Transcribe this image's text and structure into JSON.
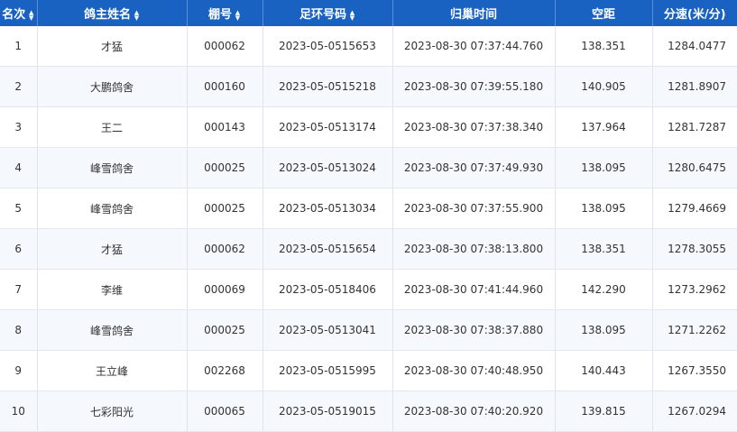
{
  "table": {
    "headers": [
      {
        "label": "名次",
        "sortable": true
      },
      {
        "label": "鸽主姓名",
        "sortable": true
      },
      {
        "label": "棚号",
        "sortable": true
      },
      {
        "label": "足环号码",
        "sortable": true
      },
      {
        "label": "归巢时间",
        "sortable": false
      },
      {
        "label": "空距",
        "sortable": false
      },
      {
        "label": "分速(米/分)",
        "sortable": false
      }
    ],
    "rows": [
      [
        "1",
        "才猛",
        "000062",
        "2023-05-0515653",
        "2023-08-30 07:37:44.760",
        "138.351",
        "1284.0477"
      ],
      [
        "2",
        "大鹏鸽舍",
        "000160",
        "2023-05-0515218",
        "2023-08-30 07:39:55.180",
        "140.905",
        "1281.8907"
      ],
      [
        "3",
        "王二",
        "000143",
        "2023-05-0513174",
        "2023-08-30 07:37:38.340",
        "137.964",
        "1281.7287"
      ],
      [
        "4",
        "峰雪鸽舍",
        "000025",
        "2023-05-0513024",
        "2023-08-30 07:37:49.930",
        "138.095",
        "1280.6475"
      ],
      [
        "5",
        "峰雪鸽舍",
        "000025",
        "2023-05-0513034",
        "2023-08-30 07:37:55.900",
        "138.095",
        "1279.4669"
      ],
      [
        "6",
        "才猛",
        "000062",
        "2023-05-0515654",
        "2023-08-30 07:38:13.800",
        "138.351",
        "1278.3055"
      ],
      [
        "7",
        "李维",
        "000069",
        "2023-05-0518406",
        "2023-08-30 07:41:44.960",
        "142.290",
        "1273.2962"
      ],
      [
        "8",
        "峰雪鸽舍",
        "000025",
        "2023-05-0513041",
        "2023-08-30 07:38:37.880",
        "138.095",
        "1271.2262"
      ],
      [
        "9",
        "王立峰",
        "002268",
        "2023-05-0515995",
        "2023-08-30 07:40:48.950",
        "140.443",
        "1267.3550"
      ],
      [
        "10",
        "七彩阳光",
        "000065",
        "2023-05-0519015",
        "2023-08-30 07:40:20.920",
        "139.815",
        "1267.0294"
      ]
    ]
  },
  "icons": {
    "sort": "sort-up-down-icon"
  },
  "colors": {
    "header_bg": "#1a62c1",
    "header_text": "#ffffff",
    "row_alt_bg": "#f5f8fd",
    "border": "#dfe4ec",
    "text": "#333333"
  }
}
